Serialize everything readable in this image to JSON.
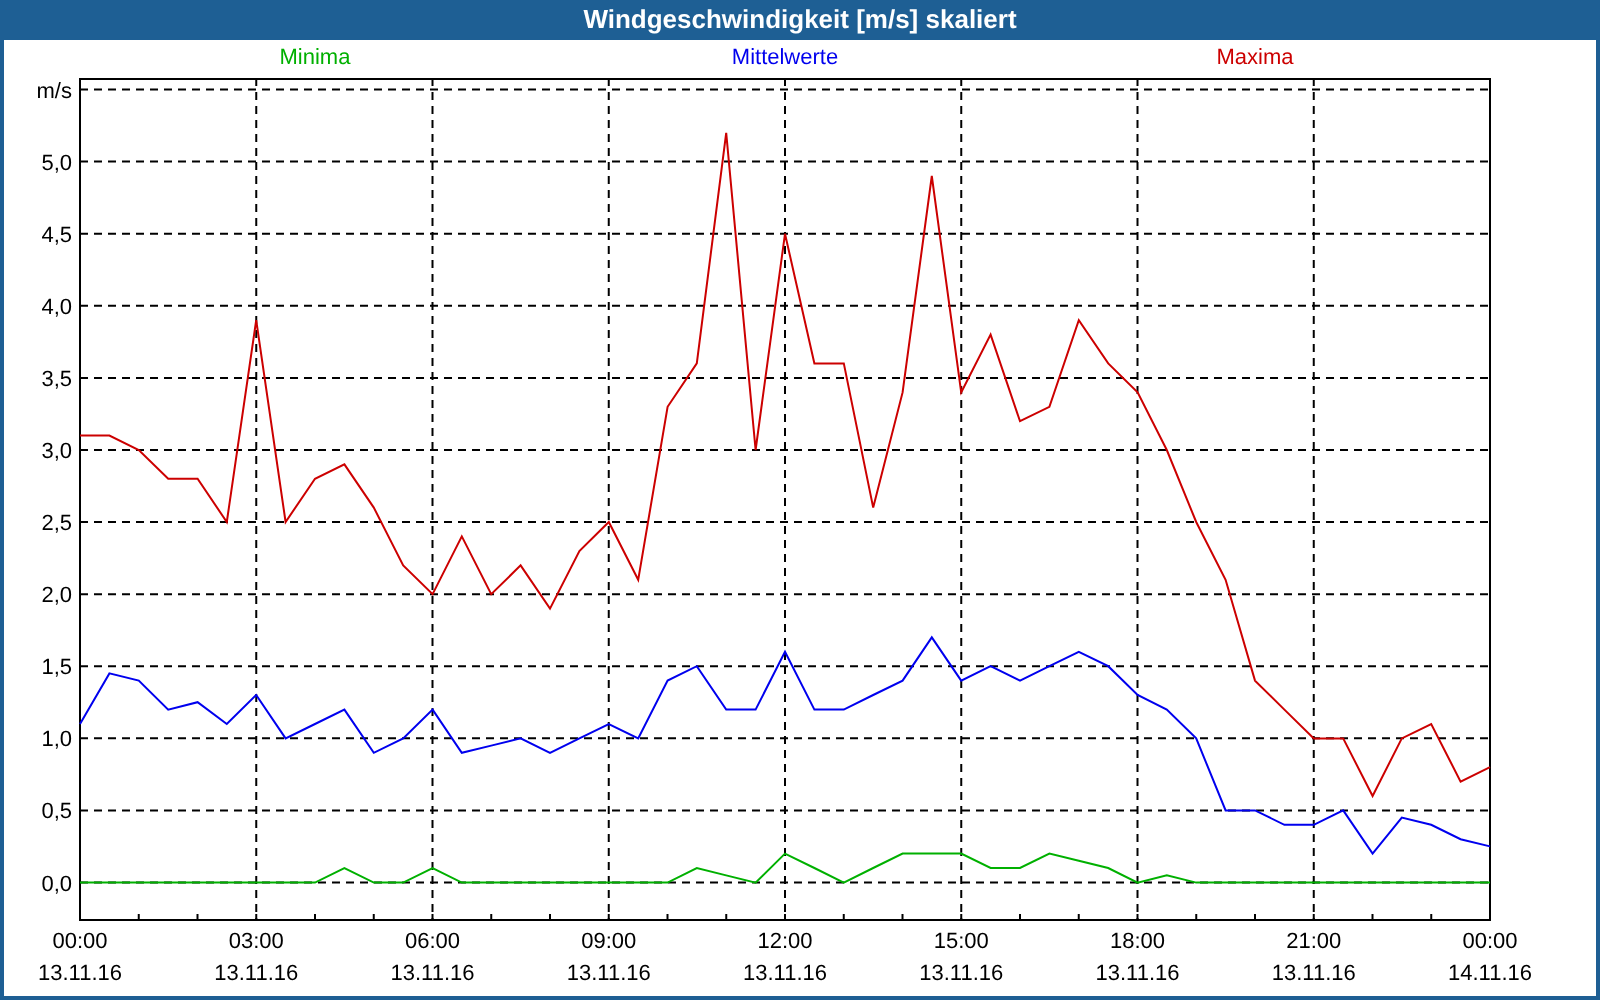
{
  "window": {
    "title": "Windgeschwindigkeit [m/s] skaliert"
  },
  "chart": {
    "chart_data": {
      "type": "line",
      "ylabel": "m/s",
      "grid": true,
      "categories": [
        "00:00\n13.11.16",
        null,
        null,
        null,
        null,
        null,
        "03:00\n13.11.16",
        null,
        null,
        null,
        null,
        null,
        "06:00\n13.11.16",
        null,
        null,
        null,
        null,
        null,
        "09:00\n13.11.16",
        null,
        null,
        null,
        null,
        null,
        "12:00\n13.11.16",
        null,
        null,
        null,
        null,
        null,
        "15:00\n13.11.16",
        null,
        null,
        null,
        null,
        null,
        "18:00\n13.11.16",
        null,
        null,
        null,
        null,
        null,
        "21:00\n13.11.16",
        null,
        null,
        null,
        null,
        null,
        "00:00\n14.11.16"
      ],
      "series": [
        {
          "name": "Minima",
          "color": "#00b000",
          "values": [
            0,
            0,
            0,
            0,
            0,
            0,
            0,
            0,
            0,
            0.1,
            0,
            0,
            0.1,
            0,
            0,
            0,
            0,
            0,
            0,
            0,
            0,
            0.1,
            0.05,
            0,
            0.2,
            0.1,
            0,
            0.1,
            0.2,
            0.2,
            0.2,
            0.1,
            0.1,
            0.2,
            0.15,
            0.1,
            0,
            0.05,
            0,
            0,
            0,
            0,
            0,
            0,
            0,
            0,
            0,
            0,
            0
          ]
        },
        {
          "name": "Mittelwerte",
          "color": "#0000ee",
          "values": [
            1.1,
            1.45,
            1.4,
            1.2,
            1.25,
            1.1,
            1.3,
            1.0,
            1.1,
            1.2,
            0.9,
            1.0,
            1.2,
            0.9,
            0.95,
            1.0,
            0.9,
            1.0,
            1.1,
            1.0,
            1.4,
            1.5,
            1.2,
            1.2,
            1.6,
            1.2,
            1.2,
            1.3,
            1.4,
            1.7,
            1.4,
            1.5,
            1.4,
            1.5,
            1.6,
            1.5,
            1.3,
            1.2,
            1.0,
            0.5,
            0.5,
            0.4,
            0.4,
            0.5,
            0.2,
            0.45,
            0.4,
            0.3,
            0.25
          ]
        },
        {
          "name": "Maxima",
          "color": "#cc0000",
          "values": [
            3.1,
            3.1,
            3.0,
            2.8,
            2.8,
            2.5,
            3.9,
            2.5,
            2.8,
            2.9,
            2.6,
            2.2,
            2.0,
            2.4,
            2.0,
            2.2,
            1.9,
            2.3,
            2.5,
            2.1,
            3.3,
            3.6,
            5.2,
            3.0,
            4.5,
            3.6,
            3.6,
            2.6,
            3.4,
            4.9,
            3.4,
            3.8,
            3.2,
            3.3,
            3.9,
            3.6,
            3.4,
            3.0,
            2.5,
            2.1,
            1.4,
            1.2,
            1.0,
            1.0,
            0.6,
            1.0,
            1.1,
            0.7,
            0.8
          ]
        }
      ],
      "ylim": [
        -0.26,
        5.58
      ],
      "yticks": [
        {
          "value": 0,
          "label": "0,0"
        },
        {
          "value": 0.5,
          "label": "0,5"
        },
        {
          "value": 1,
          "label": "1,0"
        },
        {
          "value": 1.5,
          "label": "1,5"
        },
        {
          "value": 2,
          "label": "2,0"
        },
        {
          "value": 2.5,
          "label": "2,5"
        },
        {
          "value": 3,
          "label": "3,0"
        },
        {
          "value": 3.5,
          "label": "3,5"
        },
        {
          "value": 4,
          "label": "4,0"
        },
        {
          "value": 4.5,
          "label": "4,5"
        },
        {
          "value": 5,
          "label": "5,0"
        }
      ]
    }
  }
}
